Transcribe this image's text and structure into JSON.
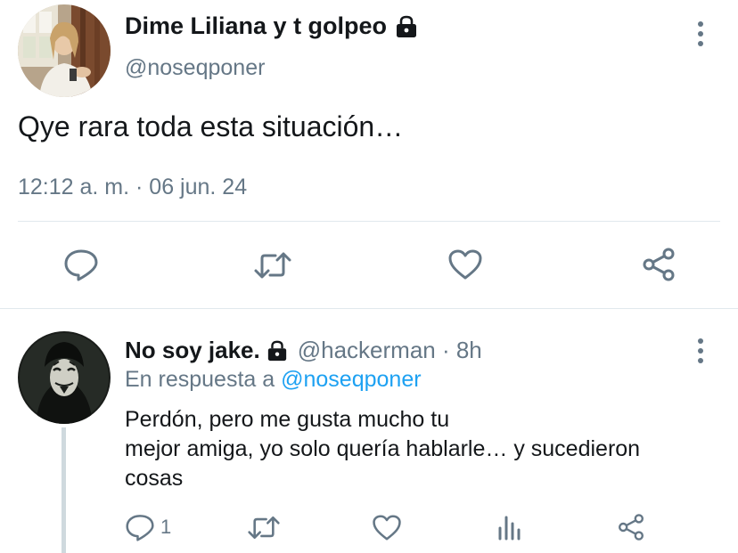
{
  "main_tweet": {
    "display_name": "Dime Liliana y t golpeo",
    "handle": "@noseqponer",
    "text": "Qye rara toda esta situación…",
    "timestamp": "12:12 a. m. · 06 jun. 24",
    "avatar_icon": "profile-photo",
    "protected_icon": "lock-icon",
    "actions": [
      "reply-icon",
      "retweet-icon",
      "like-icon",
      "share-icon"
    ]
  },
  "reply": {
    "display_name": "No soy jake.",
    "meta": "@hackerman · 8h",
    "reply_prefix": "En respuesta a",
    "reply_to": "@noseqponer",
    "text_lines": [
      "Perdón, pero me gusta mucho tu",
      "mejor amiga, yo solo quería hablarle… y sucedieron",
      "cosas"
    ],
    "reply_count": "1",
    "protected_icon": "lock-icon",
    "actions": [
      "reply-icon",
      "retweet-icon",
      "like-icon",
      "analytics-icon",
      "share-icon"
    ]
  },
  "colors": {
    "text": "#14171a",
    "secondary": "#657786",
    "link": "#1da1f2",
    "divider": "#e1e8ed"
  }
}
